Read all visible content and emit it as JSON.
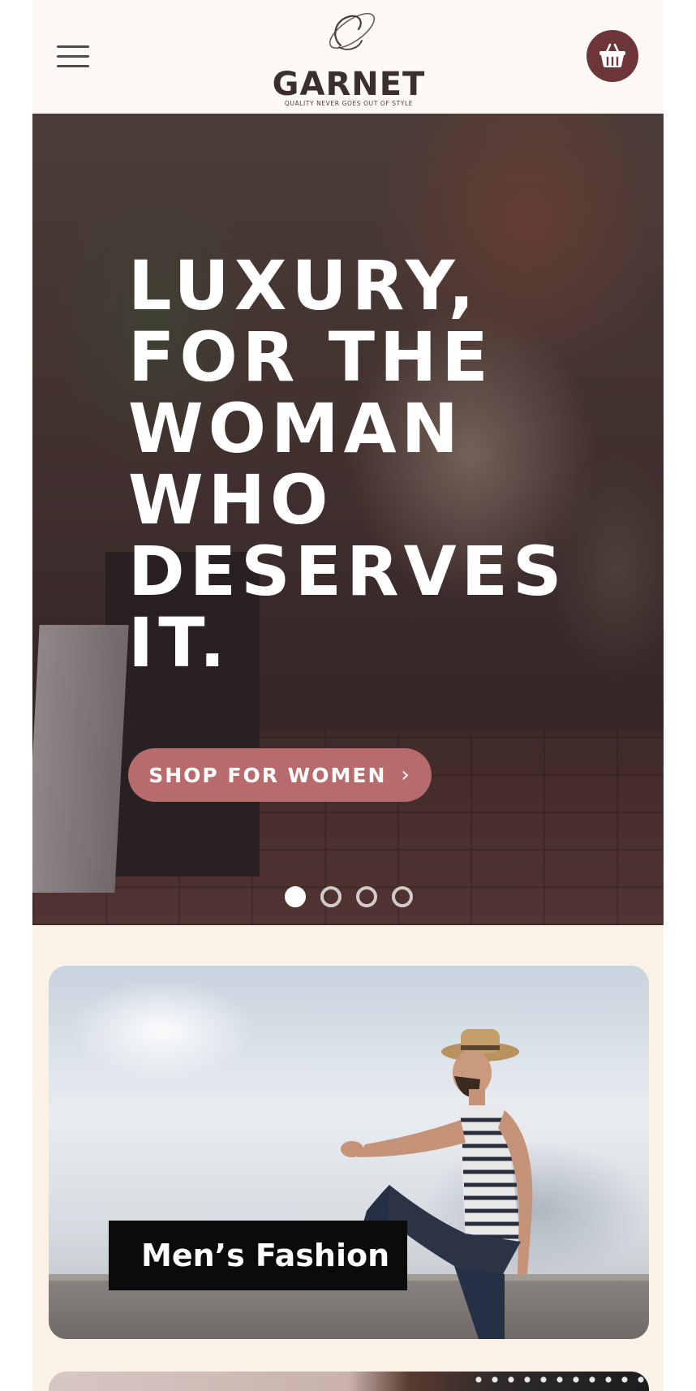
{
  "header": {
    "brand_name": "GARNET",
    "brand_tagline": "QUALITY NEVER GOES OUT OF STYLE",
    "menu_icon": "hamburger-menu-icon",
    "cart_icon": "shopping-basket-icon",
    "cart_color": "#6d3638"
  },
  "hero": {
    "heading_lines": [
      "LUXURY,",
      "FOR THE",
      "WOMAN",
      "WHO",
      "DESERVES",
      "IT."
    ],
    "cta_label": "SHOP FOR WOMEN",
    "cta_icon": "chevron-right-icon",
    "cta_color": "#b86b6c",
    "slides_total": 4,
    "active_slide": 1
  },
  "categories": [
    {
      "label": "Men’s Fashion"
    },
    {
      "label": ""
    }
  ],
  "colors": {
    "page_background": "#fbf1e6",
    "header_background": "#fcf9f7",
    "brand_text": "#3b2f2f"
  }
}
